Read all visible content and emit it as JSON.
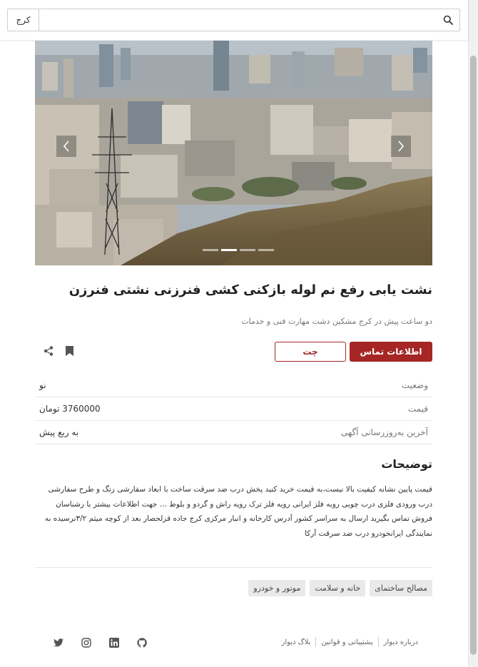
{
  "search": {
    "placeholder": "",
    "value": "",
    "city": "کرج"
  },
  "listing": {
    "title": "نشت یابی رفع نم لوله بازکنی کشی فنرزنی نشتی فنرزن",
    "subtitle": "دو ساعت پیش در کرج مشکین دشت مهارت فنی و خدمات",
    "contact_label": "اطلاعات تماس",
    "chat_label": "چت"
  },
  "info": [
    {
      "key": "وضعیت",
      "value": "نو"
    },
    {
      "key": "قیمت",
      "value": "3760000 تومان"
    },
    {
      "key": "آخرین به‌روزرسانی آگهی",
      "value": "به ربع پیش"
    }
  ],
  "description": {
    "title": "توضیحات",
    "text": "قیمت پایین نشانه کیفیت بالا نیست،به قیمت خرید کنید پخش درب ضد سرقت ساخت با ابعاد سفارشی رنگ و طرح سفارشی درب ورودی فلزی درب چوبی روبه فلز ایرانی رویه فلز ترک رویه راش و گردو و بلوط ... جهت اطلاعات بیشتر با رشناسان فروش تماس بگیرید ارسال به سراسر کشور آدرس کارخانه و انبار مرکزی کرج جاده قزلحصار بعد از کوچه میثم ۳/۲نرسیده به نمایندگی ایرانخودرو درب ضد سرقت آرکا"
  },
  "tags": [
    "مصالح ساختمای",
    "خانه و سلامت",
    "موتور و خودرو"
  ],
  "footer": {
    "links": [
      "درباره دیوار",
      "پشتیبانی و قوانین",
      "بلاگ دیوار"
    ],
    "social_icons": [
      "github-icon",
      "linkedin-icon",
      "instagram-icon",
      "twitter-icon"
    ]
  },
  "colors": {
    "accent": "#a62626"
  }
}
